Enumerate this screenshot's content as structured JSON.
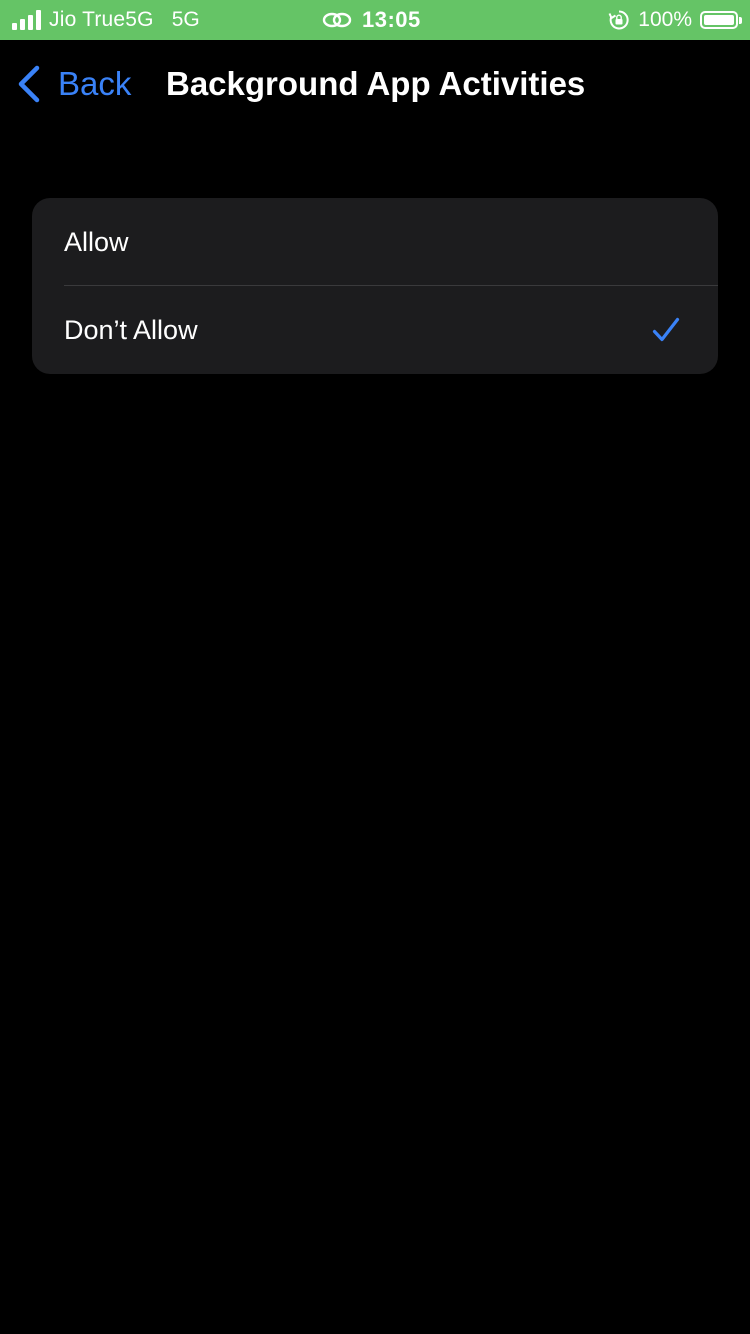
{
  "status_bar": {
    "carrier": "Jio True5G",
    "network": "5G",
    "time": "13:05",
    "battery_percent": "100%",
    "icons": [
      "signal-icon",
      "link-icon",
      "rotation-lock-icon",
      "battery-icon"
    ],
    "background_color": "#65c466",
    "battery_level": 1.0
  },
  "nav": {
    "back_label": "Back",
    "title": "Background App Activities",
    "accent_color": "#3a82f7"
  },
  "options": {
    "items": [
      {
        "label": "Allow",
        "selected": false
      },
      {
        "label": "Don’t Allow",
        "selected": true
      }
    ],
    "check_icon": "checkmark-icon",
    "group_color": "#1c1c1e"
  }
}
